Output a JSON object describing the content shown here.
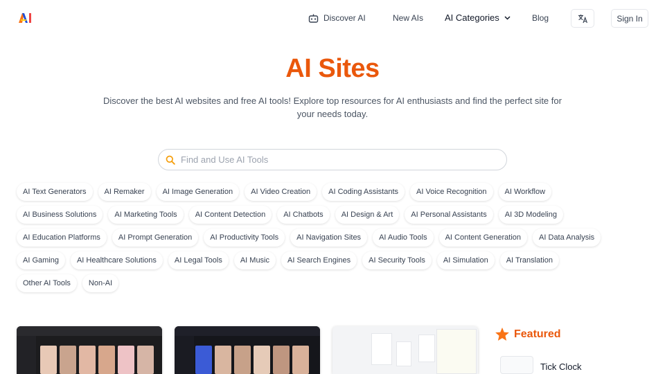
{
  "brand": {
    "logo_colors": [
      "#f97316",
      "#1d4ed8",
      "#ef4444"
    ]
  },
  "nav": {
    "discover_label": "Discover AI",
    "new_label": "New AIs",
    "categories_label": "AI Categories",
    "blog_label": "Blog",
    "signin_label": "Sign In"
  },
  "hero": {
    "title": "AI Sites",
    "subtitle": "Discover the best AI websites and free AI tools! Explore top resources for AI enthusiasts and find the perfect site for your needs today."
  },
  "search": {
    "placeholder": "Find and Use AI Tools",
    "value": ""
  },
  "tags": [
    [
      "AI Text Generators",
      "AI Remaker",
      "AI Image Generation",
      "AI Video Creation",
      "AI Coding Assistants",
      "AI Voice Recognition",
      "AI Workflow"
    ],
    [
      "AI Business Solutions",
      "AI Marketing Tools",
      "AI Content Detection",
      "AI Chatbots",
      "AI Design & Art",
      "AI Personal Assistants",
      "AI 3D Modeling"
    ],
    [
      "AI Education Platforms",
      "AI Prompt Generation",
      "AI Productivity Tools",
      "AI Navigation Sites",
      "AI Audio Tools",
      "AI Content Generation",
      "AI Data Analysis"
    ],
    [
      "AI Gaming",
      "AI Healthcare Solutions",
      "AI Legal Tools",
      "AI Music",
      "AI Search Engines",
      "AI Security Tools",
      "AI Simulation",
      "AI Translation"
    ],
    [
      "Other AI Tools",
      "Non-AI"
    ]
  ],
  "featured": {
    "label": "Featured",
    "items": [
      {
        "name": "Tick Clock"
      }
    ]
  },
  "colors": {
    "accent": "#ea580c",
    "star": "#f97316",
    "text": "#1f2937",
    "muted": "#4b5563"
  },
  "icons": {
    "discover": "robot-icon",
    "categories": "chevron-down-icon",
    "language": "translate-icon",
    "search": "search-icon",
    "featured": "star-icon"
  }
}
